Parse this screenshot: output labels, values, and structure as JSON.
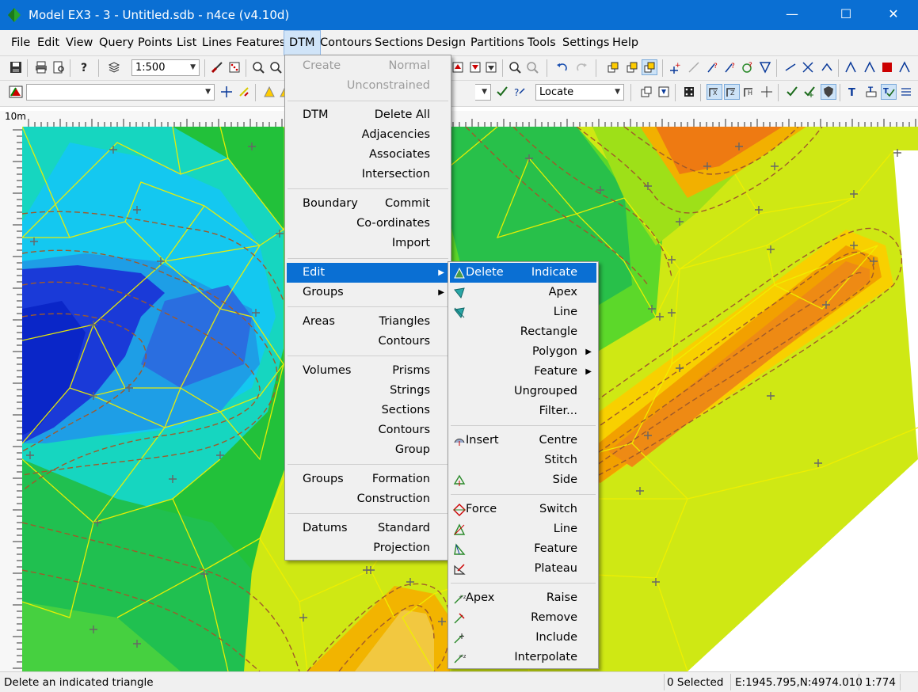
{
  "titlebar": {
    "title": "Model EX3 - 3 - Untitled.sdb - n4ce (v4.10d)",
    "minimize": "—",
    "maximize": "☐",
    "close": "✕"
  },
  "menubar": {
    "items": [
      "File",
      "Edit",
      "View",
      "Query",
      "Points",
      "List",
      "Lines",
      "Features",
      "DTM",
      "Contours",
      "Sections",
      "Design",
      "Partitions",
      "Tools",
      "Settings",
      "Help"
    ],
    "active": "DTM"
  },
  "toolbar1": {
    "scale": "1:500"
  },
  "toolbar2": {
    "feature_combo": "",
    "locate": "Locate"
  },
  "ruler": {
    "label": "10m"
  },
  "dtm_menu": {
    "rows": [
      {
        "left": "Create",
        "right": "Normal",
        "disabled": true
      },
      {
        "left": "",
        "right": "Unconstrained",
        "disabled": true
      },
      {
        "left": "DTM",
        "right": "Delete All"
      },
      {
        "left": "",
        "right": "Adjacencies"
      },
      {
        "left": "",
        "right": "Associates"
      },
      {
        "left": "",
        "right": "Intersection"
      },
      {
        "left": "Boundary",
        "right": "Commit"
      },
      {
        "left": "",
        "right": "Co-ordinates"
      },
      {
        "left": "",
        "right": "Import"
      },
      {
        "left": "Edit",
        "right": "",
        "submenu": true,
        "highlighted": true
      },
      {
        "left": "Groups",
        "right": "",
        "submenu": true
      },
      {
        "left": "Areas",
        "right": "Triangles"
      },
      {
        "left": "",
        "right": "Contours"
      },
      {
        "left": "Volumes",
        "right": "Prisms"
      },
      {
        "left": "",
        "right": "Strings"
      },
      {
        "left": "",
        "right": "Sections"
      },
      {
        "left": "",
        "right": "Contours"
      },
      {
        "left": "",
        "right": "Group"
      },
      {
        "left": "Groups",
        "right": "Formation"
      },
      {
        "left": "",
        "right": "Construction"
      },
      {
        "left": "Datums",
        "right": "Standard"
      },
      {
        "left": "",
        "right": "Projection"
      }
    ]
  },
  "edit_submenu": {
    "rows": [
      {
        "left": "Delete",
        "right": "Indicate",
        "icon": "delete-triangle-icon",
        "highlighted": true
      },
      {
        "left": "",
        "right": "Apex",
        "icon": "apex-icon"
      },
      {
        "left": "",
        "right": "Line",
        "icon": "line-delete-icon"
      },
      {
        "left": "",
        "right": "Rectangle"
      },
      {
        "left": "",
        "right": "Polygon",
        "submenu": true
      },
      {
        "left": "",
        "right": "Feature",
        "submenu": true
      },
      {
        "left": "",
        "right": "Ungrouped"
      },
      {
        "left": "",
        "right": "Filter..."
      },
      {
        "left": "Insert",
        "right": "Centre",
        "icon": "insert-icon"
      },
      {
        "left": "",
        "right": "Stitch"
      },
      {
        "left": "",
        "right": "Side",
        "icon": "side-icon"
      },
      {
        "left": "Force",
        "right": "Switch",
        "icon": "force-switch-icon"
      },
      {
        "left": "",
        "right": "Line",
        "icon": "force-line-icon"
      },
      {
        "left": "",
        "right": "Feature",
        "icon": "force-feature-icon"
      },
      {
        "left": "",
        "right": "Plateau",
        "icon": "plateau-icon"
      },
      {
        "left": "Apex",
        "right": "Raise",
        "icon": "apex-raise-icon"
      },
      {
        "left": "",
        "right": "Remove",
        "icon": "apex-remove-icon"
      },
      {
        "left": "",
        "right": "Include",
        "icon": "apex-include-icon"
      },
      {
        "left": "",
        "right": "Interpolate",
        "icon": "apex-interpolate-icon"
      }
    ]
  },
  "status": {
    "message": "Delete an indicated triangle",
    "selected": "0 Selected",
    "coords": "E:1945.795,N:4974.010",
    "scale": "1:774"
  },
  "colors": {
    "accent": "#0a6fd3",
    "contour_line": "#9a5a2a",
    "triangle_line": "#f0f000"
  }
}
